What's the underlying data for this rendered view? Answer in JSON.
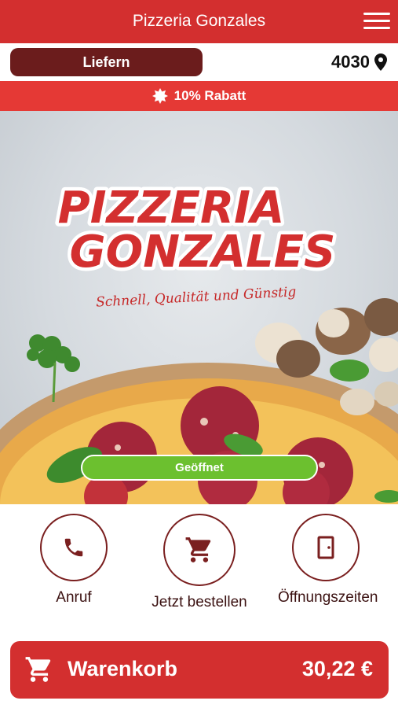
{
  "header": {
    "title": "Pizzeria Gonzales",
    "menu_icon": "hamburger-menu-icon"
  },
  "order_mode": {
    "label": "Liefern",
    "zip": "4030",
    "location_icon": "map-pin-icon"
  },
  "promo": {
    "icon": "starburst-badge-icon",
    "text": "10% Rabatt"
  },
  "hero": {
    "logo_line1": "PIZZERIA",
    "logo_line2": "GONZALES",
    "tagline": "Schnell, Qualität und Günstig",
    "status": "Geöffnet",
    "status_color": "#6cc02f"
  },
  "actions": [
    {
      "label": "Anruf",
      "icon": "phone-icon"
    },
    {
      "label": "Jetzt bestellen",
      "icon": "shopping-cart-icon"
    },
    {
      "label": "Öffnungszeiten",
      "icon": "door-icon"
    }
  ],
  "cart": {
    "label": "Warenkorb",
    "total": "30,22 €",
    "icon": "shopping-cart-icon"
  },
  "colors": {
    "brand_red": "#d32f2f",
    "promo_red": "#e53935",
    "dark_maroon": "#6b1c1c",
    "open_green": "#6cc02f"
  }
}
